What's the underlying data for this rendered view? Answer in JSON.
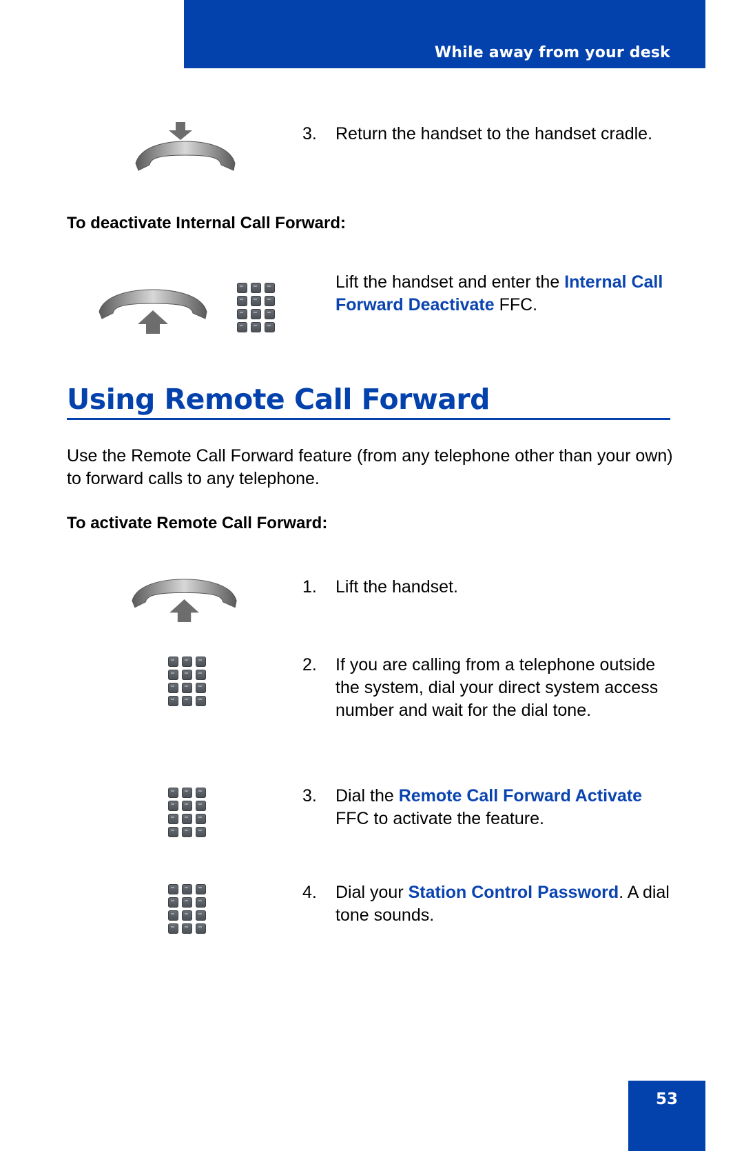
{
  "header": {
    "title": "While away from your desk"
  },
  "return_step": {
    "number": "3.",
    "text": "Return the handset to the handset cradle."
  },
  "deactivate_internal": {
    "heading": "To deactivate Internal Call Forward:",
    "text_before": "Lift the handset and enter the ",
    "link": "Internal Call Forward Deactivate",
    "text_after": " FFC."
  },
  "section": {
    "title": "Using Remote Call Forward",
    "intro": "Use the Remote Call Forward feature (from any telephone other than your own) to forward calls to any telephone.",
    "activate_heading": "To activate Remote Call Forward:",
    "steps": [
      {
        "number": "1.",
        "text": "Lift the handset."
      },
      {
        "number": "2.",
        "text": "If you are calling from a telephone outside the system, dial your direct system access number and wait for the dial tone."
      },
      {
        "number": "3.",
        "text_before": "Dial the ",
        "link": "Remote Call Forward Activate",
        "text_after": " FFC to activate the feature."
      },
      {
        "number": "4.",
        "text_before": "Dial your ",
        "link": "Station Control Password",
        "text_after": ". A dial tone sounds."
      }
    ]
  },
  "icons": {
    "return_handset": "handset-down-icon",
    "lift_handset": "handset-up-icon",
    "dialpad": "dialpad-icon"
  },
  "footer": {
    "page_number": "53"
  },
  "colors": {
    "brand_blue": "#0341ad",
    "link_blue": "#0a44b0"
  }
}
